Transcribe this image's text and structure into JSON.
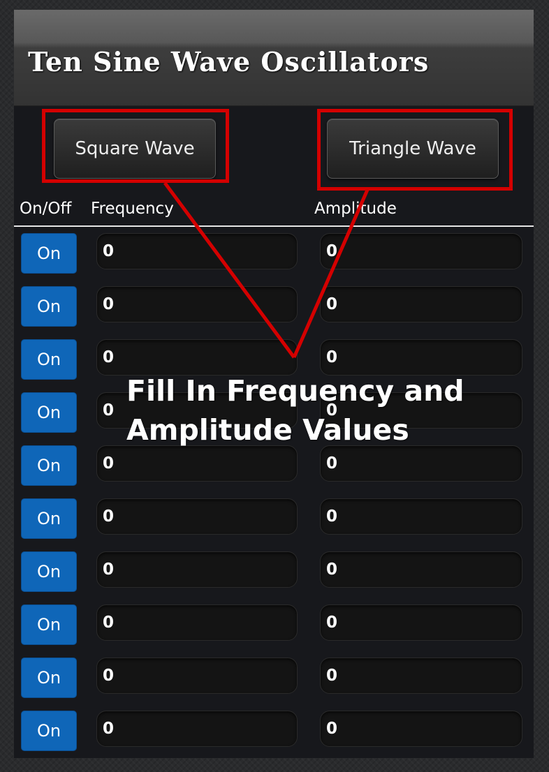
{
  "app": {
    "title": "Ten Sine Wave Oscillators"
  },
  "buttons": {
    "square_wave": "Square Wave",
    "triangle_wave": "Triangle Wave"
  },
  "columns": {
    "on_off": "On/Off",
    "frequency": "Frequency",
    "amplitude": "Amplitude"
  },
  "oscillators": [
    {
      "toggle": "On",
      "frequency": "0",
      "amplitude": "0"
    },
    {
      "toggle": "On",
      "frequency": "0",
      "amplitude": "0"
    },
    {
      "toggle": "On",
      "frequency": "0",
      "amplitude": "0"
    },
    {
      "toggle": "On",
      "frequency": "0",
      "amplitude": "0"
    },
    {
      "toggle": "On",
      "frequency": "0",
      "amplitude": "0"
    },
    {
      "toggle": "On",
      "frequency": "0",
      "amplitude": "0"
    },
    {
      "toggle": "On",
      "frequency": "0",
      "amplitude": "0"
    },
    {
      "toggle": "On",
      "frequency": "0",
      "amplitude": "0"
    },
    {
      "toggle": "On",
      "frequency": "0",
      "amplitude": "0"
    },
    {
      "toggle": "On",
      "frequency": "0",
      "amplitude": "0"
    }
  ],
  "annotation": {
    "line1": "Fill In Frequency and",
    "line2": "Amplitude Values"
  },
  "colors": {
    "on_button": "#0f66b8",
    "highlight": "#d40000",
    "panel": "#17181c"
  }
}
